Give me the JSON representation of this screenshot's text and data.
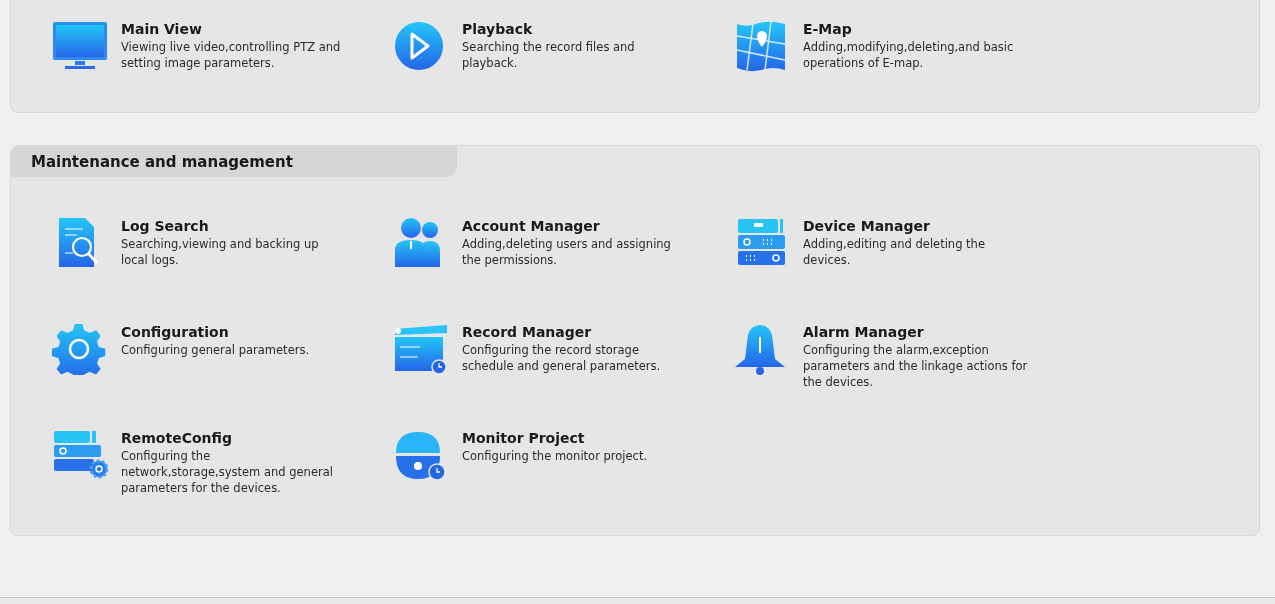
{
  "sections": [
    {
      "modules": [
        {
          "kind": "monitor",
          "title": "Main View",
          "description": [
            "Viewing live video,controlling PTZ and",
            "setting image parameters."
          ]
        },
        {
          "kind": "play",
          "title": "Playback",
          "description": [
            "Searching the record files and",
            "playback."
          ]
        },
        {
          "kind": "map",
          "title": "E-Map",
          "description": [
            "Adding,modifying,deleting,and basic",
            "operations of E-map."
          ]
        }
      ]
    },
    {
      "title": "Maintenance and management",
      "modules": [
        {
          "kind": "log",
          "title": "Log Search",
          "description": [
            "Searching,viewing and backing up",
            "local logs."
          ]
        },
        {
          "kind": "account",
          "title": "Account Manager",
          "description": [
            "Adding,deleting users and assigning",
            "the permissions."
          ]
        },
        {
          "kind": "device",
          "title": "Device Manager",
          "description": [
            "Adding,editing and deleting the",
            "devices."
          ]
        },
        {
          "kind": "gear",
          "title": "Configuration",
          "description": [
            "Configuring general parameters."
          ]
        },
        {
          "kind": "record",
          "title": "Record Manager",
          "description": [
            "Configuring the record storage",
            "schedule and general parameters."
          ]
        },
        {
          "kind": "alarm",
          "title": "Alarm Manager",
          "description": [
            "Configuring the alarm,exception",
            "parameters and the linkage actions for",
            "the devices."
          ]
        },
        {
          "kind": "remote",
          "title": "RemoteConfig",
          "description": [
            "Configuring the",
            "network,storage,system and general",
            "parameters for the devices."
          ]
        },
        {
          "kind": "monitorproject",
          "title": "Monitor Project",
          "description": [
            "Configuring the monitor project."
          ]
        }
      ]
    }
  ]
}
